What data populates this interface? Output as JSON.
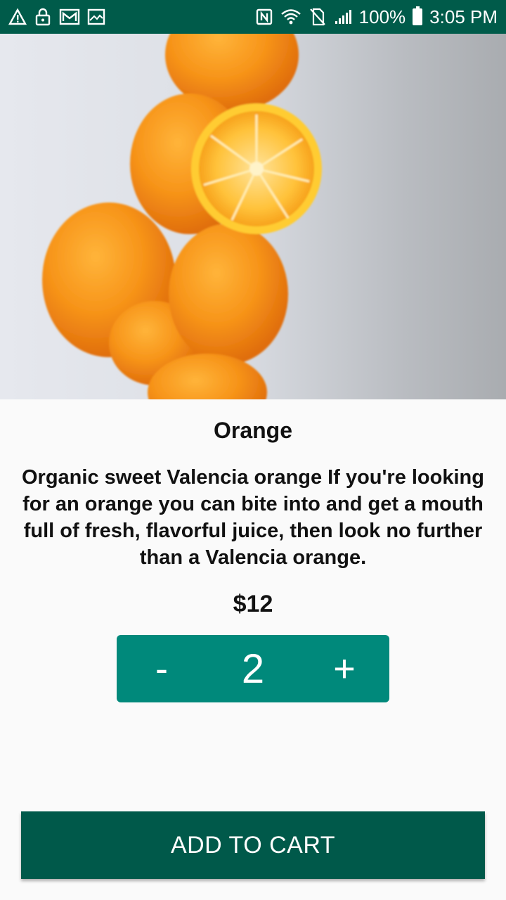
{
  "status_bar": {
    "battery_percent": "100%",
    "time": "3:05 PM",
    "left_icons": [
      "warning-icon",
      "lock-icon",
      "gmail-icon",
      "image-icon"
    ],
    "right_icons": [
      "nfc-icon",
      "wifi-icon",
      "no-sim-icon",
      "signal-icon",
      "battery-icon"
    ]
  },
  "product": {
    "image_subject": "oranges",
    "title": "Orange",
    "description": "Organic sweet Valencia orange If you're looking for an orange you can bite into and get a mouth full of fresh, flavorful juice, then look no further than a Valencia orange.",
    "price": "$12"
  },
  "quantity": {
    "decrement_label": "-",
    "value": "2",
    "increment_label": "+"
  },
  "actions": {
    "add_to_cart_label": "ADD TO CART"
  },
  "colors": {
    "status_bar": "#005b4a",
    "stepper": "#00897b",
    "add_to_cart": "#00594a",
    "background": "#fafafa"
  }
}
